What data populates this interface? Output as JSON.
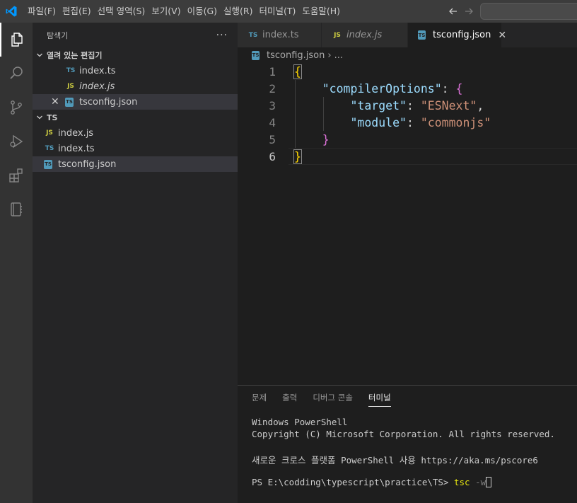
{
  "titlebar": {
    "menus": [
      "파일(F)",
      "편집(E)",
      "선택 영역(S)",
      "보기(V)",
      "이동(G)",
      "실행(R)",
      "터미널(T)",
      "도움말(H)"
    ]
  },
  "activity_bar": {
    "items": [
      "explorer-icon",
      "search-icon",
      "source-control-icon",
      "run-debug-icon",
      "extensions-icon",
      "notebook-icon"
    ]
  },
  "sidebar": {
    "title": "탐색기",
    "more": "···",
    "open_editors": {
      "header": "열려 있는 편집기",
      "files": [
        {
          "icon": "TS",
          "name": "index.ts"
        },
        {
          "icon": "JS",
          "name": "index.js"
        },
        {
          "icon": "TS",
          "name": "tsconfig.json"
        }
      ]
    },
    "folder": {
      "header": "TS",
      "files": [
        {
          "icon": "JS",
          "name": "index.js"
        },
        {
          "icon": "TS",
          "name": "index.ts"
        },
        {
          "icon": "TS",
          "name": "tsconfig.json"
        }
      ]
    }
  },
  "tabs": [
    {
      "icon": "TS",
      "label": "index.ts"
    },
    {
      "icon": "JS",
      "label": "index.js"
    },
    {
      "icon": "TS",
      "label": "tsconfig.json",
      "close": "✕"
    }
  ],
  "breadcrumb": {
    "file": "tsconfig.json",
    "sep": "›",
    "rest": "..."
  },
  "editor": {
    "line_numbers": [
      "1",
      "2",
      "3",
      "4",
      "5",
      "6"
    ],
    "lines": {
      "l1_brace": "{",
      "l2_key": "\"compilerOptions\"",
      "l2_colon": ": ",
      "l2_brace": "{",
      "l3_key": "\"target\"",
      "l3_colon": ": ",
      "l3_val": "\"ESNext\"",
      "l3_comma": ",",
      "l4_key": "\"module\"",
      "l4_colon": ": ",
      "l4_val": "\"commonjs\"",
      "l5_brace": "}",
      "l6_brace": "}"
    }
  },
  "panel": {
    "tabs": [
      "문제",
      "출력",
      "디버그 콘솔",
      "터미널"
    ],
    "terminal": {
      "line1": "Windows PowerShell",
      "line2": "Copyright (C) Microsoft Corporation. All rights reserved.",
      "line3": "새로운 크로스 플랫폼 PowerShell 사용 https://aka.ms/pscore6",
      "prompt": "PS E:\\codding\\typescript\\practice\\TS> ",
      "cmd": "tsc",
      "arg": " -w"
    }
  },
  "colors": {
    "accent_logo": "#0098ff",
    "ts_icon": "#519aba",
    "js_icon": "#cbcb41"
  }
}
